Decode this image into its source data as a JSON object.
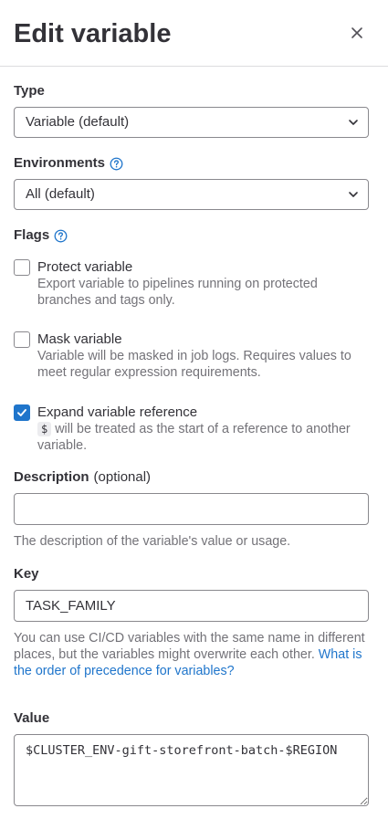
{
  "header": {
    "title": "Edit variable"
  },
  "type": {
    "label": "Type",
    "selected": "Variable (default)"
  },
  "environments": {
    "label": "Environments",
    "selected": "All (default)"
  },
  "flags": {
    "label": "Flags",
    "protect": {
      "label": "Protect variable",
      "help": "Export variable to pipelines running on protected branches and tags only.",
      "checked": false
    },
    "mask": {
      "label": "Mask variable",
      "help": "Variable will be masked in job logs. Requires values to meet regular expression requirements.",
      "checked": false
    },
    "expand": {
      "label": "Expand variable reference",
      "code": "$",
      "help": "will be treated as the start of a reference to another variable.",
      "checked": true
    }
  },
  "description": {
    "label": "Description",
    "optional": "(optional)",
    "value": "",
    "help": "The description of the variable's value or usage."
  },
  "key": {
    "label": "Key",
    "value": "TASK_FAMILY",
    "help": "You can use CI/CD variables with the same name in different places, but the variables might overwrite each other.",
    "link": "What is the order of precedence for variables?"
  },
  "value": {
    "label": "Value",
    "value": "$CLUSTER_ENV-gift-storefront-batch-$REGION"
  },
  "colors": {
    "accent": "#1f75cb",
    "text": "#333238",
    "muted": "#737278",
    "border": "#89888d"
  }
}
